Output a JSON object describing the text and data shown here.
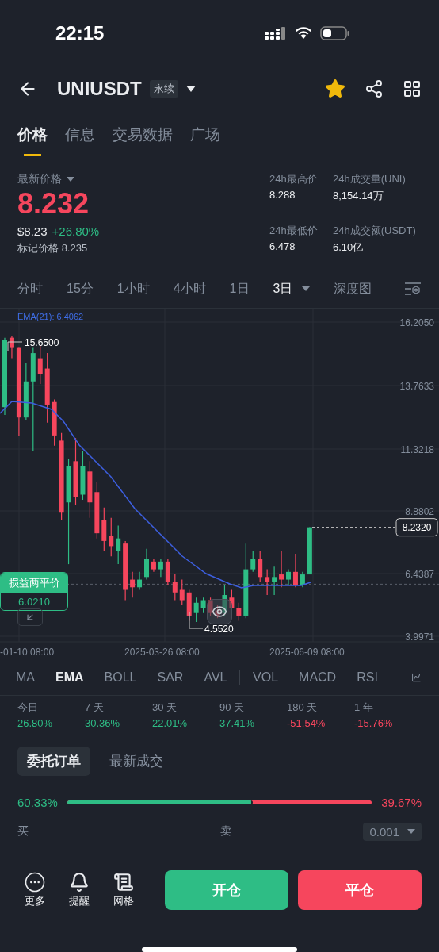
{
  "status_bar": {
    "time": "22:15"
  },
  "header": {
    "symbol": "UNIUSDT",
    "badge": "永续",
    "favorite": true
  },
  "tabs": [
    {
      "label": "价格",
      "selected": true
    },
    {
      "label": "信息",
      "selected": false
    },
    {
      "label": "交易数据",
      "selected": false
    },
    {
      "label": "广场",
      "selected": false
    }
  ],
  "price": {
    "label": "最新价格",
    "last": "8.232",
    "usd": "$8.23",
    "change": "+26.80%",
    "mark_label": "标记价格",
    "mark": "8.235"
  },
  "stats": [
    {
      "label": "24h最高价",
      "value": "8.288"
    },
    {
      "label": "24h成交量(UNI)",
      "value": "8,154.14万"
    },
    {
      "label": "24h最低价",
      "value": "6.478"
    },
    {
      "label": "24h成交额(USDT)",
      "value": "6.10亿"
    }
  ],
  "intervals": [
    {
      "label": "分时",
      "selected": false
    },
    {
      "label": "15分",
      "selected": false
    },
    {
      "label": "1小时",
      "selected": false
    },
    {
      "label": "4小时",
      "selected": false
    },
    {
      "label": "1日",
      "selected": false
    },
    {
      "label": "3日",
      "selected": true
    }
  ],
  "depth_chart": "深度图",
  "chart": {
    "indicator_label": "EMA(21): 6.4062",
    "y_labels": [
      "16.2050",
      "13.7633",
      "11.3218",
      "8.8802",
      "6.4387",
      "3.9971"
    ],
    "high_label": "15.6500",
    "low_label": "4.5520",
    "last_price": "8.2320",
    "breakeven": {
      "label": "损益两平价",
      "value": "6.0210"
    },
    "x_labels": [
      "-01-10 08:00",
      "2025-03-26 08:00",
      "2025-06-09 08:00"
    ]
  },
  "indicator_groups": [
    {
      "items": [
        {
          "label": "MA",
          "selected": false
        },
        {
          "label": "EMA",
          "selected": true
        },
        {
          "label": "BOLL",
          "selected": false
        },
        {
          "label": "SAR",
          "selected": false
        },
        {
          "label": "AVL",
          "selected": false
        }
      ]
    },
    {
      "items": [
        {
          "label": "VOL",
          "selected": false
        },
        {
          "label": "MACD",
          "selected": false
        },
        {
          "label": "RSI",
          "selected": false
        }
      ]
    }
  ],
  "performance": [
    {
      "period": "今日",
      "change": "26.80%",
      "color": "#2ebd85"
    },
    {
      "period": "7 天",
      "change": "30.36%",
      "color": "#2ebd85"
    },
    {
      "period": "30 天",
      "change": "22.01%",
      "color": "#2ebd85"
    },
    {
      "period": "90 天",
      "change": "37.41%",
      "color": "#2ebd85"
    },
    {
      "period": "180 天",
      "change": "-51.54%",
      "color": "#f6465d"
    },
    {
      "period": "1 年",
      "change": "-15.76%",
      "color": "#f6465d"
    }
  ],
  "orders": {
    "tabs": [
      {
        "label": "委托订单",
        "selected": true
      },
      {
        "label": "最新成交",
        "selected": false
      }
    ],
    "buy_pct": "60.33%",
    "sell_pct": "39.67%",
    "level": 0.6033,
    "buy_label": "买",
    "sell_label": "卖",
    "precision": "0.001"
  },
  "bottom_bar": {
    "actions": [
      {
        "label": "更多",
        "kind": "more"
      },
      {
        "label": "提醒",
        "kind": "alert"
      },
      {
        "label": "网格",
        "kind": "grid"
      }
    ],
    "open": "开仓",
    "close": "平仓"
  }
}
